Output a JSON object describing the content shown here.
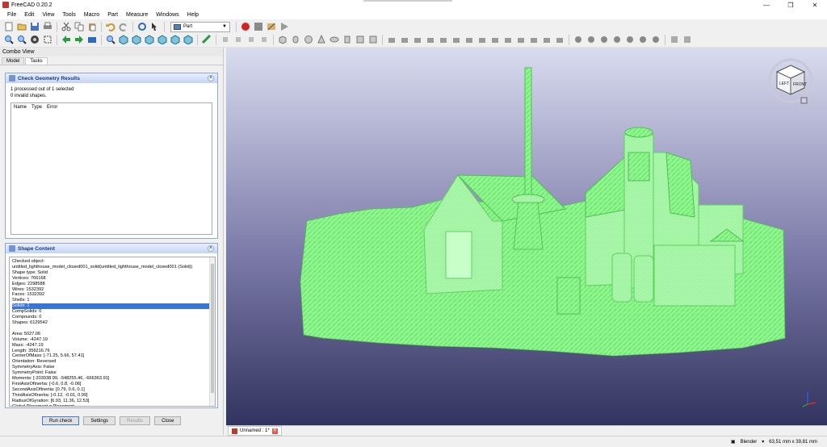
{
  "window": {
    "title": "FreeCAD 0.20.2",
    "minimize": "—",
    "maximize": "❐",
    "close": "✕"
  },
  "menu": [
    "File",
    "Edit",
    "View",
    "Tools",
    "Macro",
    "Part",
    "Measure",
    "Windows",
    "Help"
  ],
  "toolbar": {
    "workbench": "Part"
  },
  "combo_view": {
    "title": "Combo View",
    "tabs": [
      "Model",
      "Tasks"
    ]
  },
  "check_geometry": {
    "title": "Check Geometry Results",
    "info": [
      "1 processed out of 1 selected",
      "0 invalid shapes."
    ],
    "columns": [
      "Name",
      "Type",
      "Error"
    ]
  },
  "shape_content": {
    "title": "Shape Content",
    "lines": [
      "Checked object:",
      "untitled_lighthouse_model_closed001_solid(untitled_lighthouse_model_closed001 (Solid))",
      "Shape type:  Solid",
      "Vertices:  766168",
      "Edges:  2298588",
      "Wires:  1532392",
      "Faces:  1532392",
      "Shells:  1",
      "Solids:  1",
      "CompSolids:  0",
      "Compounds:  0",
      "Shapes:  6129542",
      "",
      "Area:  5027.06",
      "Volume:  -4247.19",
      "Mass:  -4247.19",
      "Length:  356216.76",
      "CenterOfMass:  [-71.25, 5.66, 57.41]",
      "Orientation:  Reversed",
      "SymmetryAxis:  False",
      "SymmetryPoint:  False",
      "Moments:  [-203938.99, -548255.46, -666363.91]",
      "FirstAxisOfInertia:  [-0.6, 0.8, -0.06]",
      "SecondAxisOfInertia:  [0.79, 0.6, 0.1]",
      "ThirdAxisOfInertia:  [-0.12, -0.01, 0.99]",
      "RadiusOfGyration:  [6.93, 11.36, 12.53]",
      "Global Placement = Placement"
    ],
    "highlighted": [
      "Solids:  1"
    ]
  },
  "buttons": {
    "run_check": "Run check",
    "settings": "Settings",
    "results": "Results",
    "close": "Close"
  },
  "navcube": {
    "left": "LEFT",
    "front": "FRONT"
  },
  "document_tab": {
    "label": "Unnamed : 1*"
  },
  "status": {
    "navigation": "Blender",
    "dimensions": "63,51 mm x 39,81 mm"
  },
  "colors": {
    "model": "#7df37d",
    "bg_top": "#d9dcef",
    "bg_bottom": "#33335f",
    "accent": "#153a84"
  }
}
